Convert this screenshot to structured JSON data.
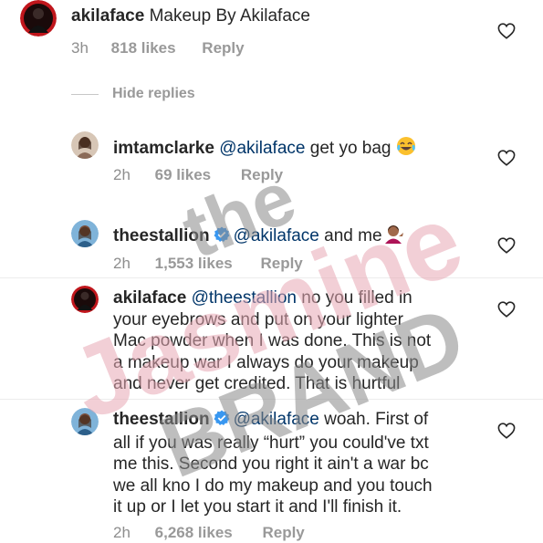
{
  "comments": [
    {
      "username": "akilaface",
      "text": "Makeup By Akilaface",
      "time": "3h",
      "likes": "818 likes",
      "reply": "Reply"
    },
    {
      "username": "imtamclarke",
      "mention": "@akilaface",
      "text": "get yo bag",
      "emoji": "😂",
      "time": "2h",
      "likes": "69 likes",
      "reply": "Reply"
    },
    {
      "username": "theestallion",
      "verified": true,
      "mention": "@akilaface",
      "text": "and me",
      "emoji": "💁🏽‍♀️",
      "time": "2h",
      "likes": "1,553 likes",
      "reply": "Reply"
    },
    {
      "username": "akilaface",
      "mention": "@theestallion",
      "text_lines": [
        "no you filled in",
        "your eyebrows and put on your lighter",
        "Mac powder when I was done. This is not",
        "a makeup war I always do your makeup",
        "and never get credited. That is hurtful"
      ]
    },
    {
      "username": "theestallion",
      "verified": true,
      "mention": "@akilaface",
      "text_lines": [
        "woah. First of",
        "all if you was really “hurt” you could've txt",
        "me this. Second you right it ain't a war bc",
        "we all kno I do my makeup and you touch",
        "it up or I let you start it and I'll finish it."
      ],
      "time": "2h",
      "likes": "6,268 likes",
      "reply": "Reply"
    }
  ],
  "hide_replies": "Hide replies",
  "watermark": {
    "line1": "the",
    "line2": "Jasmine",
    "line3": "BRAND"
  },
  "colors": {
    "meta_gray": "#999999",
    "mention_blue": "#003569",
    "verified_blue": "#3897f0",
    "watermark_pink": "#e8a9b5",
    "watermark_gray": "#8a8a8a"
  },
  "icons": {
    "heart": "heart-outline-icon",
    "verified": "verified-badge-icon"
  }
}
